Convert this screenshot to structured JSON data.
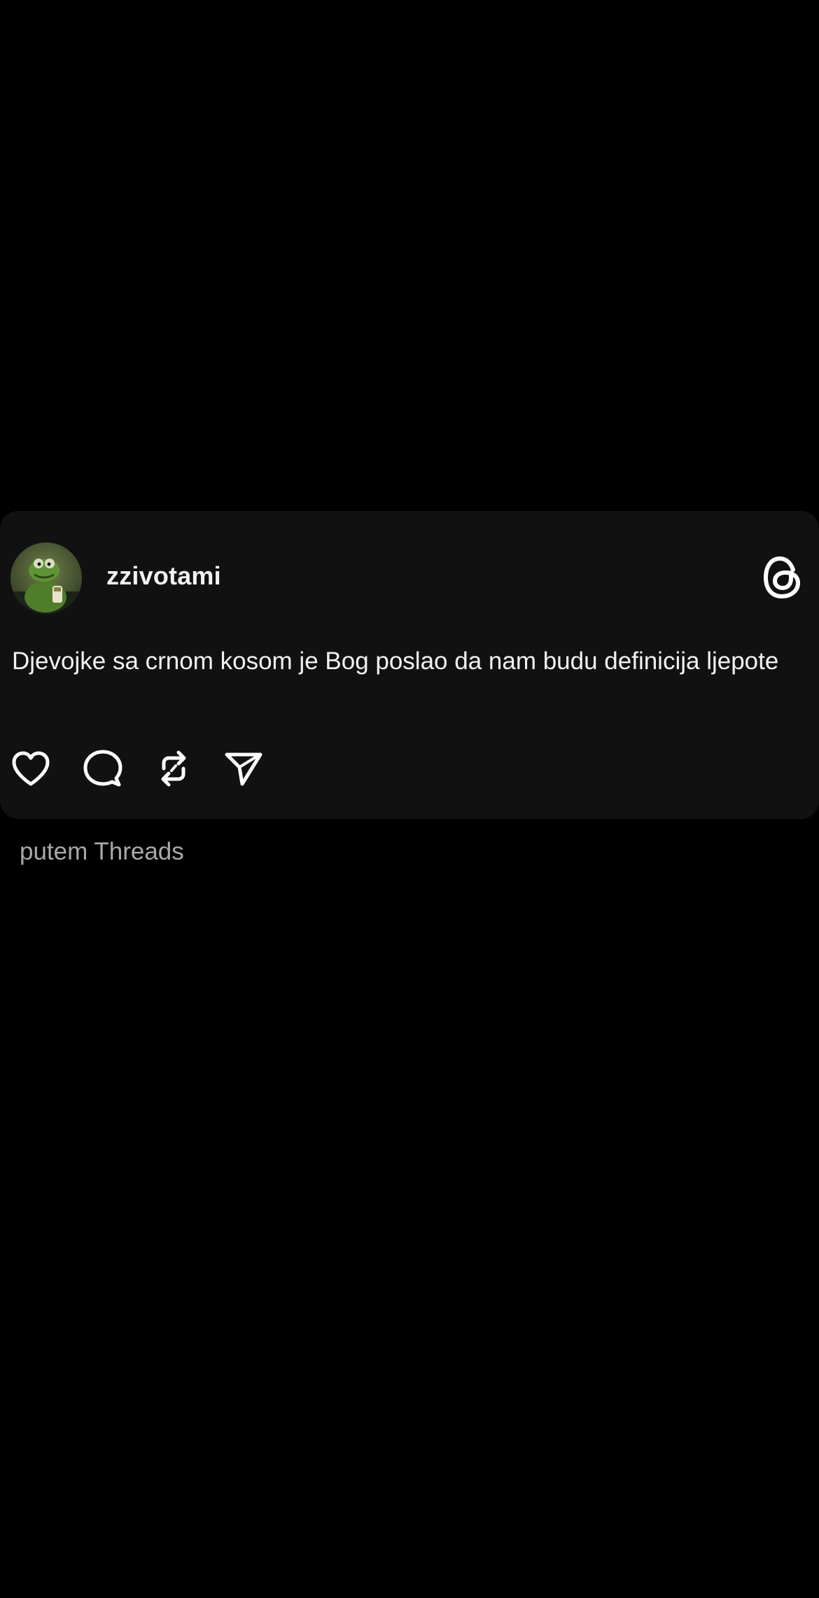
{
  "post": {
    "username": "zzivotami",
    "text": "Djevojke sa crnom kosom je Bog poslao da nam budu definicija ljepote",
    "avatar": "kermit-avatar",
    "brand_icon": "threads-logo-icon",
    "actions": [
      {
        "name": "like",
        "icon": "heart-icon"
      },
      {
        "name": "comment",
        "icon": "comment-icon"
      },
      {
        "name": "repost",
        "icon": "repost-icon"
      },
      {
        "name": "share",
        "icon": "send-icon"
      }
    ]
  },
  "footer": {
    "text": "putem Threads"
  },
  "colors": {
    "background": "#000000",
    "card": "#111112",
    "text": "#f2f2f2",
    "muted": "#a9a9a9"
  }
}
